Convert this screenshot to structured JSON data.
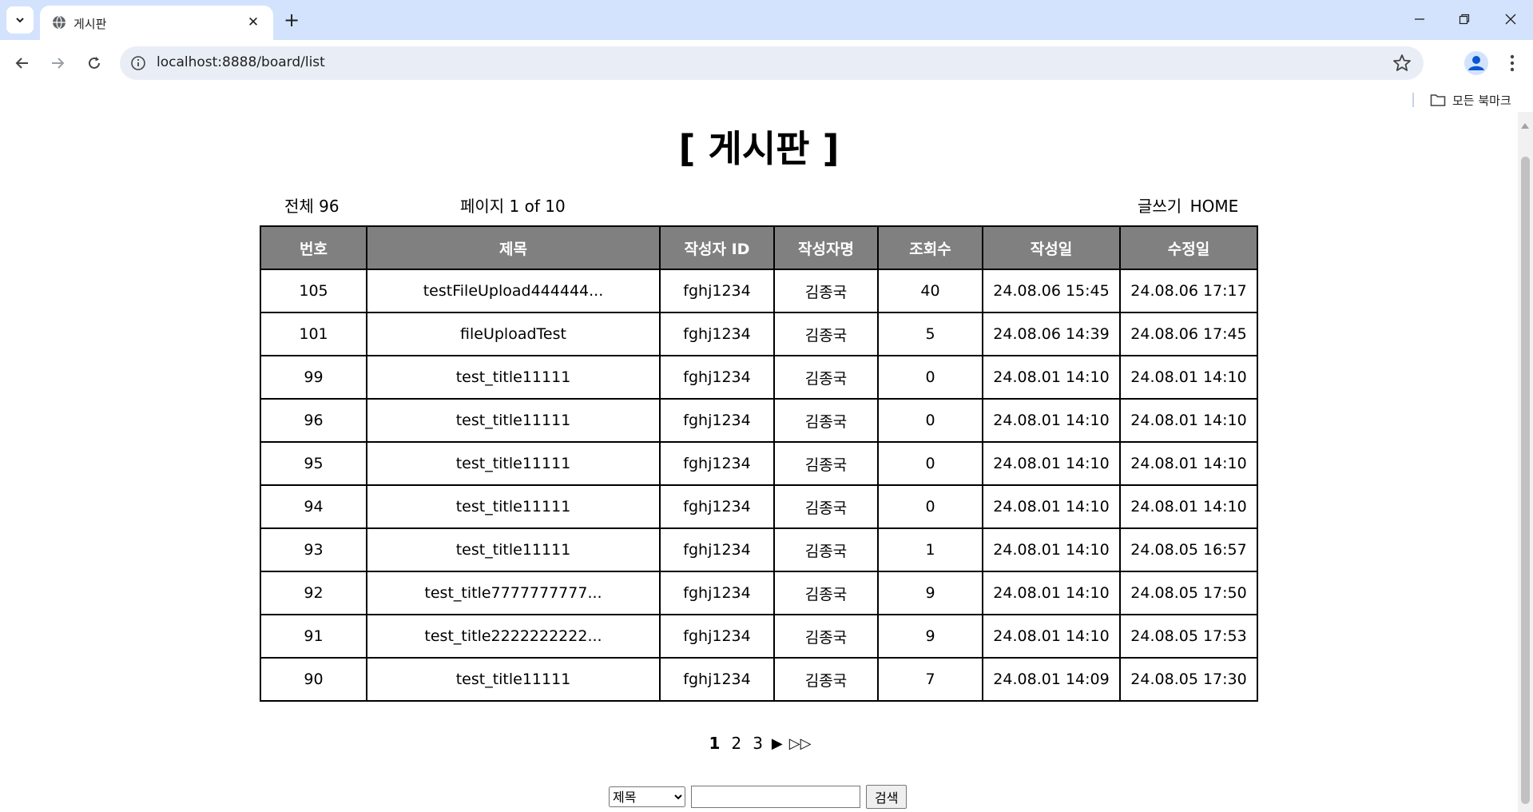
{
  "browser": {
    "tab_title": "게시판",
    "url": "localhost:8888/board/list",
    "bookmarks_folder": "모든 북마크"
  },
  "page": {
    "title": "[ 게시판 ]",
    "total": "전체 96",
    "page_info": "페이지 1 of 10",
    "write_link": "글쓰기",
    "home_link": "HOME"
  },
  "table": {
    "headers": [
      "번호",
      "제목",
      "작성자 ID",
      "작성자명",
      "조회수",
      "작성일",
      "수정일"
    ],
    "rows": [
      [
        "105",
        "testFileUpload444444...",
        "fghj1234",
        "김종국",
        "40",
        "24.08.06 15:45",
        "24.08.06 17:17"
      ],
      [
        "101",
        "fileUploadTest",
        "fghj1234",
        "김종국",
        "5",
        "24.08.06 14:39",
        "24.08.06 17:45"
      ],
      [
        "99",
        "test_title11111",
        "fghj1234",
        "김종국",
        "0",
        "24.08.01 14:10",
        "24.08.01 14:10"
      ],
      [
        "96",
        "test_title11111",
        "fghj1234",
        "김종국",
        "0",
        "24.08.01 14:10",
        "24.08.01 14:10"
      ],
      [
        "95",
        "test_title11111",
        "fghj1234",
        "김종국",
        "0",
        "24.08.01 14:10",
        "24.08.01 14:10"
      ],
      [
        "94",
        "test_title11111",
        "fghj1234",
        "김종국",
        "0",
        "24.08.01 14:10",
        "24.08.01 14:10"
      ],
      [
        "93",
        "test_title11111",
        "fghj1234",
        "김종국",
        "1",
        "24.08.01 14:10",
        "24.08.05 16:57"
      ],
      [
        "92",
        "test_title7777777777...",
        "fghj1234",
        "김종국",
        "9",
        "24.08.01 14:10",
        "24.08.05 17:50"
      ],
      [
        "91",
        "test_title2222222222...",
        "fghj1234",
        "김종국",
        "9",
        "24.08.01 14:10",
        "24.08.05 17:53"
      ],
      [
        "90",
        "test_title11111",
        "fghj1234",
        "김종국",
        "7",
        "24.08.01 14:09",
        "24.08.05 17:30"
      ]
    ]
  },
  "pagination": {
    "pages": [
      "1",
      "2",
      "3"
    ],
    "current": "1",
    "next": "▶",
    "last": "▷▷"
  },
  "search": {
    "selected_option": "제목",
    "button_label": "검색",
    "query": ""
  }
}
